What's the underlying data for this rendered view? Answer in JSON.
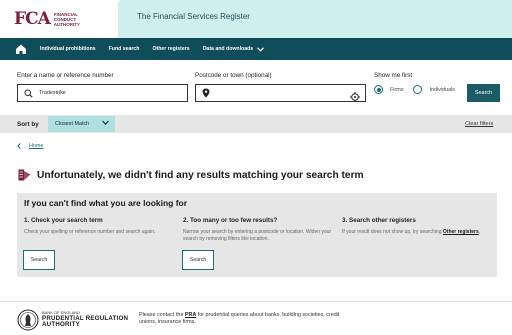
{
  "header": {
    "logo_mark": "FCA",
    "logo_text": [
      "FINANCIAL",
      "CONDUCT",
      "AUTHORITY"
    ],
    "site_title": "The Financial Services Register"
  },
  "nav": {
    "items": [
      {
        "label": "Individual prohibitions"
      },
      {
        "label": "Fund search"
      },
      {
        "label": "Other registers"
      },
      {
        "label": "Data and downloads"
      }
    ]
  },
  "search": {
    "name_label": "Enter a name or reference number",
    "name_value": "Tradestrike",
    "postcode_label": "Postcode or town (optional)",
    "postcode_value": "",
    "show_first_label": "Show me first",
    "option_firms": "Firms",
    "option_individuals": "Individuals",
    "selected": "Firms",
    "button_label": "Search"
  },
  "sort": {
    "label": "Sort by",
    "selected": "Closest Match",
    "clear_filters": "Clear filters"
  },
  "breadcrumb": {
    "home": "Home"
  },
  "results": {
    "message": "Unfortunately, we didn't find any results matching your search term"
  },
  "help": {
    "title": "If you can't find what you are looking for",
    "columns": [
      {
        "heading": "1. Check your search term",
        "text": "Check your spelling or reference number and search again.",
        "button": "Search"
      },
      {
        "heading": "2. Too many or too few results?",
        "text": "Narrow your search by entering a postcode or location. Widen your search by removing filters like location.",
        "button": "Search"
      },
      {
        "heading": "3. Search other registers",
        "text_before": "If your result does not show up, try searching ",
        "link": "Other registers",
        "text_after": "."
      }
    ]
  },
  "footer": {
    "prra_line1": "BANK OF ENGLAND",
    "prra_line2": "PRUDENTIAL REGULATION",
    "prra_line3": "AUTHORITY",
    "note_before": "Please contact the ",
    "note_link": "PRA",
    "note_after": " for prudential queries about banks, building societies, credit unions, insurance firms."
  },
  "colors": {
    "brand": "#7a1f3d",
    "nav": "#0f4d5a",
    "accent": "#1b5c67",
    "header_tint": "#cfeeee",
    "sort_highlight": "#aee0df"
  }
}
